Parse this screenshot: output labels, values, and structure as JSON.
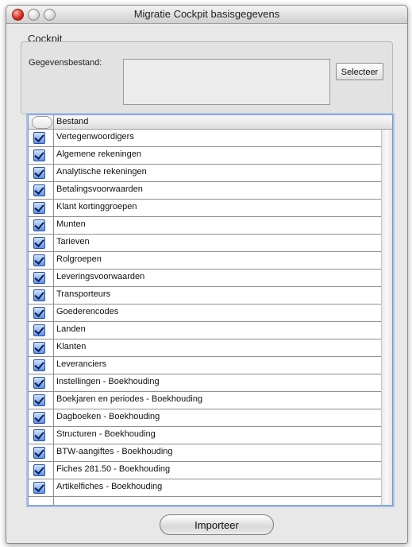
{
  "window": {
    "title": "Migratie Cockpit basisgegevens"
  },
  "group": {
    "label": "Cockpit",
    "field_label": "Gegevensbestand:",
    "file_value": "",
    "select_button": "Selecteer"
  },
  "table": {
    "header": "Bestand",
    "rows": [
      {
        "label": "Vertegenwoordigers",
        "checked": true
      },
      {
        "label": "Algemene rekeningen",
        "checked": true
      },
      {
        "label": "Analytische rekeningen",
        "checked": true
      },
      {
        "label": "Betalingsvoorwaarden",
        "checked": true
      },
      {
        "label": "Klant kortinggroepen",
        "checked": true
      },
      {
        "label": "Munten",
        "checked": true
      },
      {
        "label": "Tarieven",
        "checked": true
      },
      {
        "label": "Rolgroepen",
        "checked": true
      },
      {
        "label": "Leveringsvoorwaarden",
        "checked": true
      },
      {
        "label": "Transporteurs",
        "checked": true
      },
      {
        "label": "Goederencodes",
        "checked": true
      },
      {
        "label": "Landen",
        "checked": true
      },
      {
        "label": "Klanten",
        "checked": true
      },
      {
        "label": "Leveranciers",
        "checked": true
      },
      {
        "label": "Instellingen - Boekhouding",
        "checked": true
      },
      {
        "label": "Boekjaren en periodes - Boekhouding",
        "checked": true
      },
      {
        "label": "Dagboeken - Boekhouding",
        "checked": true
      },
      {
        "label": "Structuren - Boekhouding",
        "checked": true
      },
      {
        "label": "BTW-aangiftes - Boekhouding",
        "checked": true
      },
      {
        "label": "Fiches 281.50 - Boekhouding",
        "checked": true
      },
      {
        "label": "Artikelfiches - Boekhouding",
        "checked": true
      }
    ]
  },
  "footer": {
    "import_button": "Importeer"
  },
  "icons": {
    "close": "close-icon",
    "minimize": "minimize-icon",
    "zoom": "zoom-icon",
    "checkbox": "checkbox-checked-icon"
  },
  "colors": {
    "accent": "#5f93e6",
    "close_button": "#d7281c",
    "table_focus": "#a9c2e8"
  }
}
